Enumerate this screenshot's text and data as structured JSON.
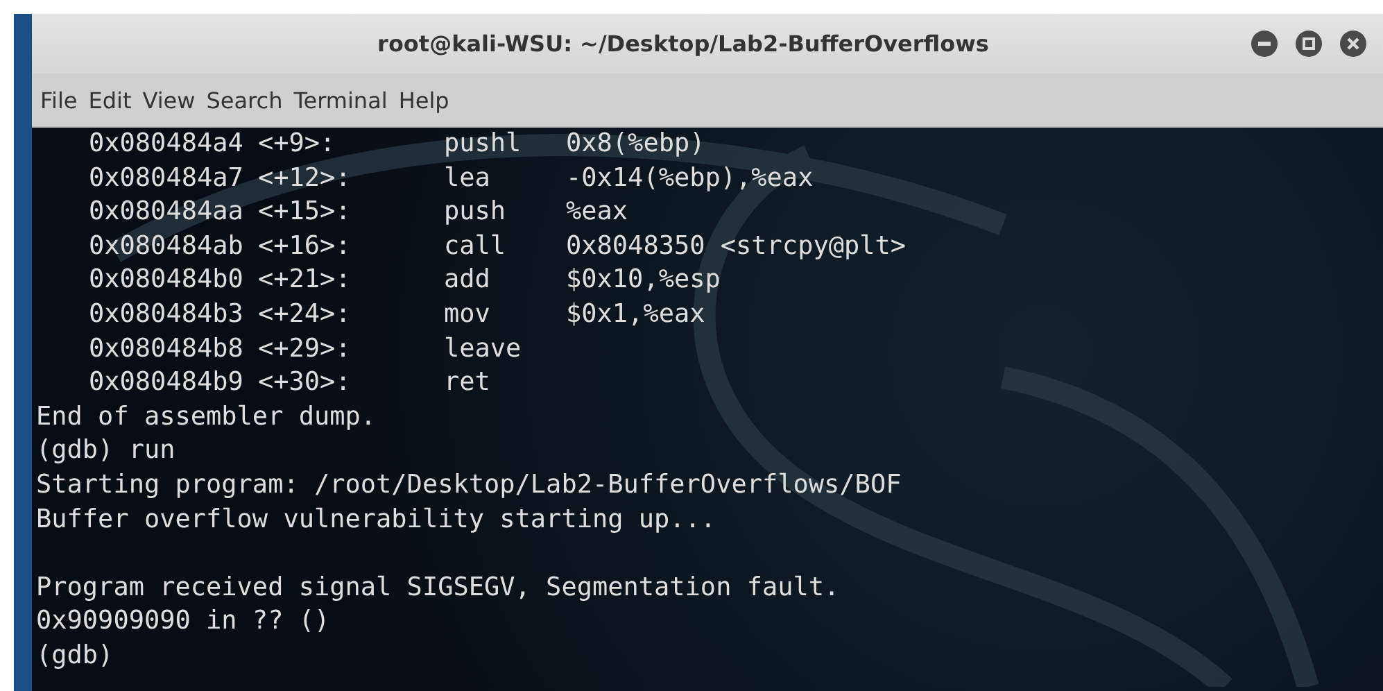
{
  "window": {
    "title": "root@kali-WSU: ~/Desktop/Lab2-BufferOverflows"
  },
  "menu": [
    {
      "label": "File"
    },
    {
      "label": "Edit"
    },
    {
      "label": "View"
    },
    {
      "label": "Search"
    },
    {
      "label": "Terminal"
    },
    {
      "label": "Help"
    }
  ],
  "terminal": {
    "disassembly": [
      {
        "address": "0x080484a4",
        "offset": "<+9>:",
        "mnemonic": "pushl",
        "operand": "0x8(%ebp)"
      },
      {
        "address": "0x080484a7",
        "offset": "<+12>:",
        "mnemonic": "lea",
        "operand": "-0x14(%ebp),%eax"
      },
      {
        "address": "0x080484aa",
        "offset": "<+15>:",
        "mnemonic": "push",
        "operand": "%eax"
      },
      {
        "address": "0x080484ab",
        "offset": "<+16>:",
        "mnemonic": "call",
        "operand": "0x8048350 <strcpy@plt>"
      },
      {
        "address": "0x080484b0",
        "offset": "<+21>:",
        "mnemonic": "add",
        "operand": "$0x10,%esp"
      },
      {
        "address": "0x080484b3",
        "offset": "<+24>:",
        "mnemonic": "mov",
        "operand": "$0x1,%eax"
      },
      {
        "address": "0x080484b8",
        "offset": "<+29>:",
        "mnemonic": "leave"
      },
      {
        "address": "0x080484b9",
        "offset": "<+30>:",
        "mnemonic": "ret"
      }
    ],
    "output": [
      {
        "kind": "text",
        "text": "End of assembler dump."
      },
      {
        "kind": "text",
        "text": "(gdb) run"
      },
      {
        "kind": "text",
        "text": "Starting program: /root/Desktop/Lab2-BufferOverflows/BOF"
      },
      {
        "kind": "text",
        "text": "Buffer overflow vulnerability starting up..."
      },
      {
        "kind": "blank"
      },
      {
        "kind": "text",
        "text": "Program received signal SIGSEGV, Segmentation fault."
      },
      {
        "kind": "text",
        "text": "0x90909090 in ?? ()"
      },
      {
        "kind": "text",
        "text": "(gdb)"
      }
    ]
  }
}
